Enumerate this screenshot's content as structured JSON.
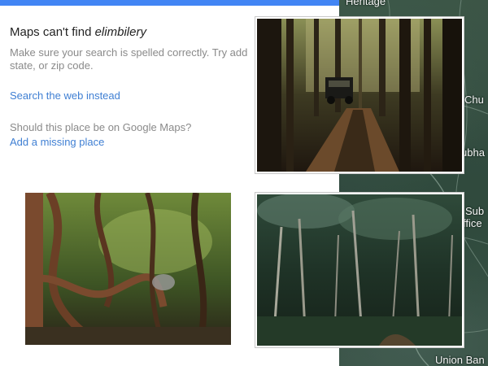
{
  "map": {
    "labels": [
      "Heritage",
      "Chu",
      "ubha",
      "Sub",
      "ffice",
      "Union Ban"
    ]
  },
  "panel": {
    "title_prefix": "Maps can't find ",
    "query": "elimbilery",
    "hint": "Make sure your search is spelled correctly. Try add state, or zip code.",
    "search_web_label": "Search the web instead",
    "question": "Should this place be on Google Maps?",
    "add_place_label": "Add a missing place"
  },
  "photos": {
    "jeep": "forest-road-with-jeep-photo",
    "vines": "twisted-vines-forest-photo",
    "palms": "palm-grove-forest-photo"
  },
  "colors": {
    "accent": "#4285f4",
    "link": "#3f7fd3"
  }
}
